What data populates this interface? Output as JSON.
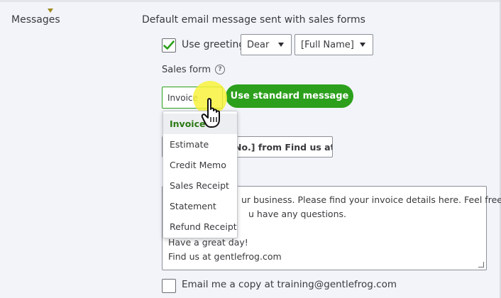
{
  "section": {
    "label": "Messages",
    "description": "Default email message sent with sales forms"
  },
  "greeting": {
    "checkbox_checked": true,
    "label": "Use greeting",
    "salutation": "Dear",
    "name_format": "[Full Name]"
  },
  "sales_form": {
    "label": "Sales form",
    "help_icon": "?",
    "selected": "Invoice",
    "options": [
      "Invoice",
      "Estimate",
      "Credit Memo",
      "Sales Receipt",
      "Statement",
      "Refund Receipt"
    ]
  },
  "standard_message_button": "Use standard message",
  "subject": {
    "label_visible_tail": "e",
    "value_visible": "No.] from Find us at ge"
  },
  "message_body": {
    "line1": "ur business. Please find your invoice details here. Feel free",
    "line2": "u have any questions.",
    "line3": "Have a great day!",
    "line4": "Find us at gentlefrog.com"
  },
  "email_copy": {
    "checkbox_checked": false,
    "label": "Email me a copy at training@gentlefrog.com"
  },
  "colors": {
    "accent_green": "#2ca01c",
    "selected_text_green": "#2a7a14",
    "highlight_yellow": "#f8f23c"
  }
}
